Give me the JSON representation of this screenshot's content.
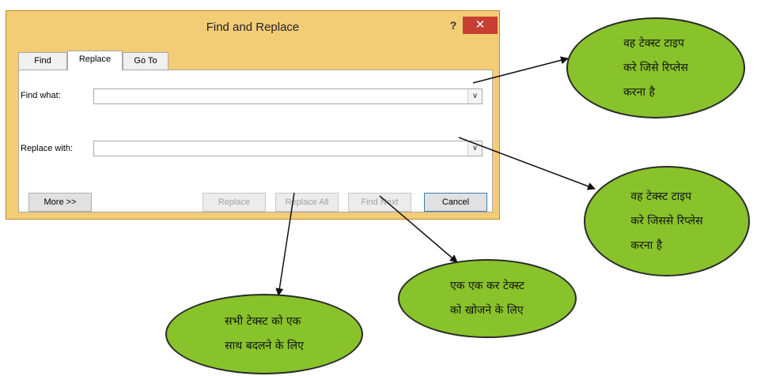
{
  "dialog": {
    "title": "Find and Replace",
    "help_label": "?",
    "close_label": "✕",
    "tabs": [
      {
        "label": "Find",
        "active": false
      },
      {
        "label": "Replace",
        "active": true
      },
      {
        "label": "Go To",
        "active": false
      }
    ],
    "find_what": {
      "label": "Find what:",
      "value": ""
    },
    "replace_with": {
      "label": "Replace with:",
      "value": ""
    },
    "dropdown_icon": "chevron-down-icon",
    "buttons": {
      "more": "More >>",
      "replace": "Replace",
      "replace_all": "Replace All",
      "find_next": "Find Next",
      "cancel": "Cancel"
    }
  },
  "annotations": {
    "find_what_note": "वह टेक्स्ट टाइप\nकरे जिसे रिप्लेस\nकरना है",
    "replace_with_note": "वह टेक्स्ट टाइप\nकरे जिससे रिप्लेस\nकरना है",
    "find_next_note": "एक एक कर टेक्स्ट\nको खोजने के लिए",
    "replace_all_note": "सभी टेक्स्ट को एक\nसाथ बदलने के लिए"
  },
  "colors": {
    "dialog_frame": "#f3cc76",
    "close_button": "#c73e32",
    "bubble_fill": "#88c32b"
  }
}
